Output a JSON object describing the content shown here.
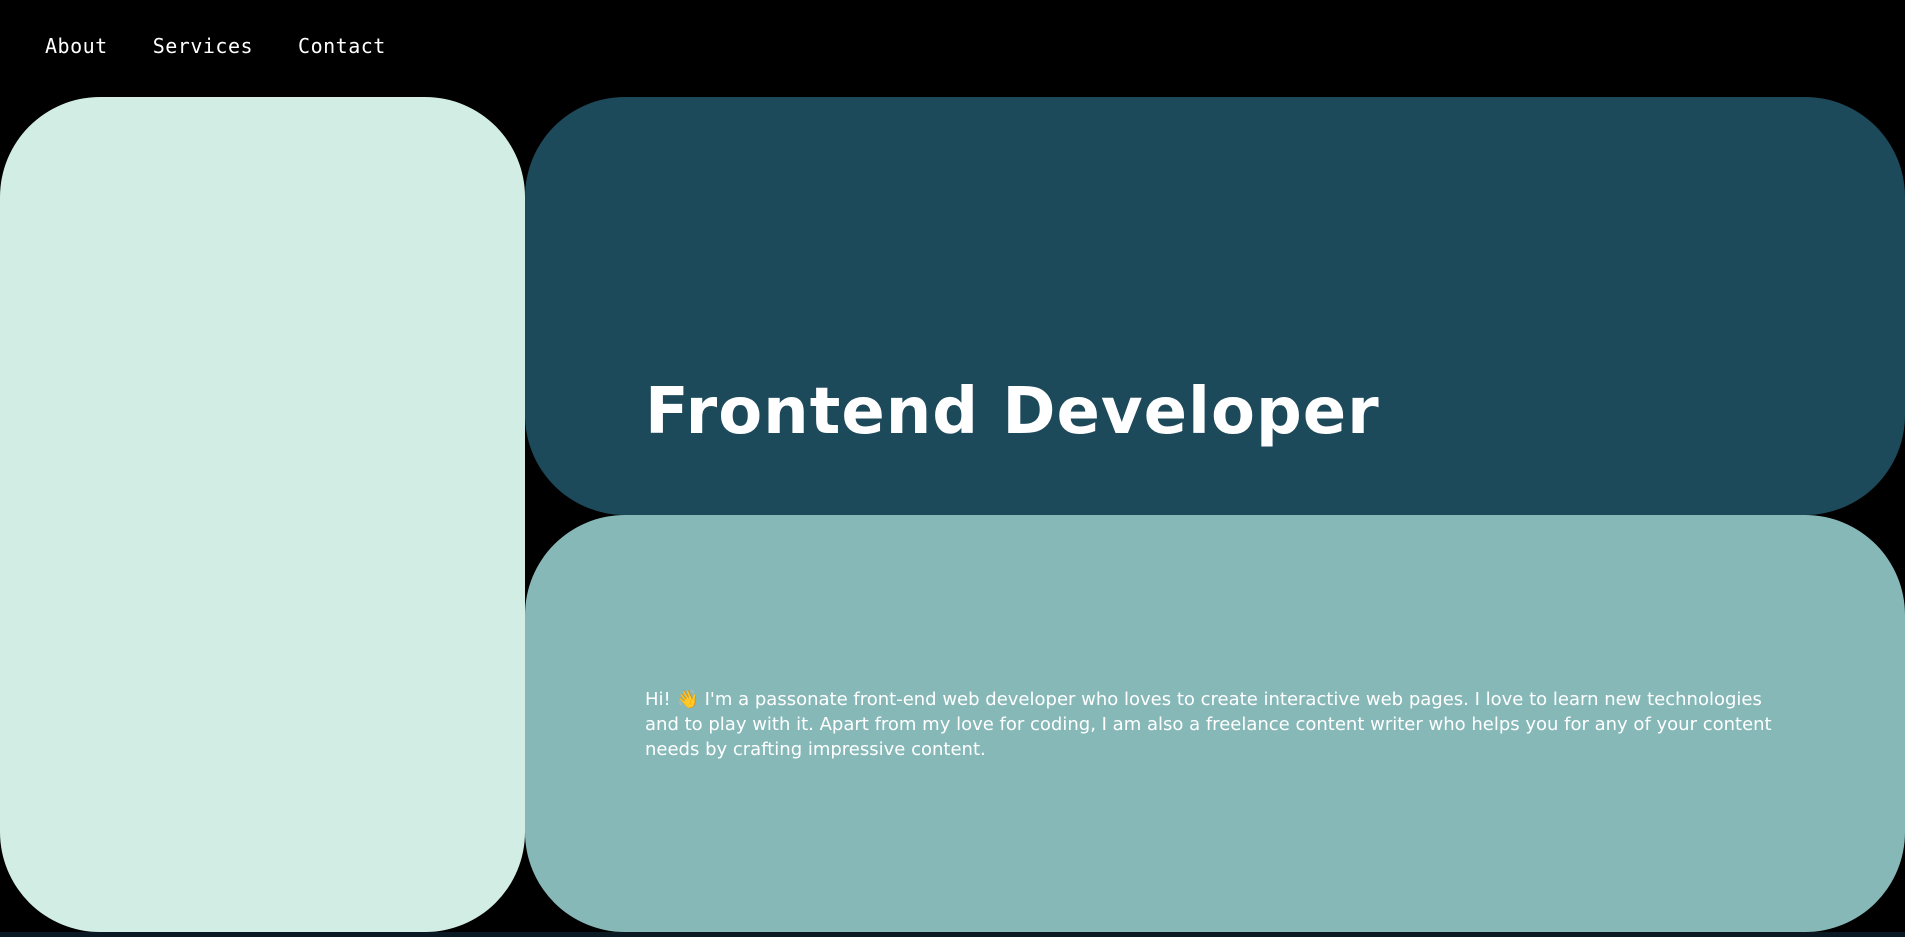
{
  "nav": {
    "items": [
      {
        "label": "About"
      },
      {
        "label": "Services"
      },
      {
        "label": "Contact"
      }
    ]
  },
  "hero": {
    "title": "Frontend Developer",
    "intro": "Hi! 👋 I'm a passonate front-end web developer who loves to create interactive web pages. I love to learn new technologies and to play with it. Apart from my love for coding, I am also a freelance content writer who helps you for any of your content needs by crafting impressive content."
  },
  "colors": {
    "background": "#000000",
    "left_panel": "#d2ede4",
    "title_panel": "#1d4a5b",
    "intro_panel": "#87b8b8",
    "text": "#ffffff"
  }
}
